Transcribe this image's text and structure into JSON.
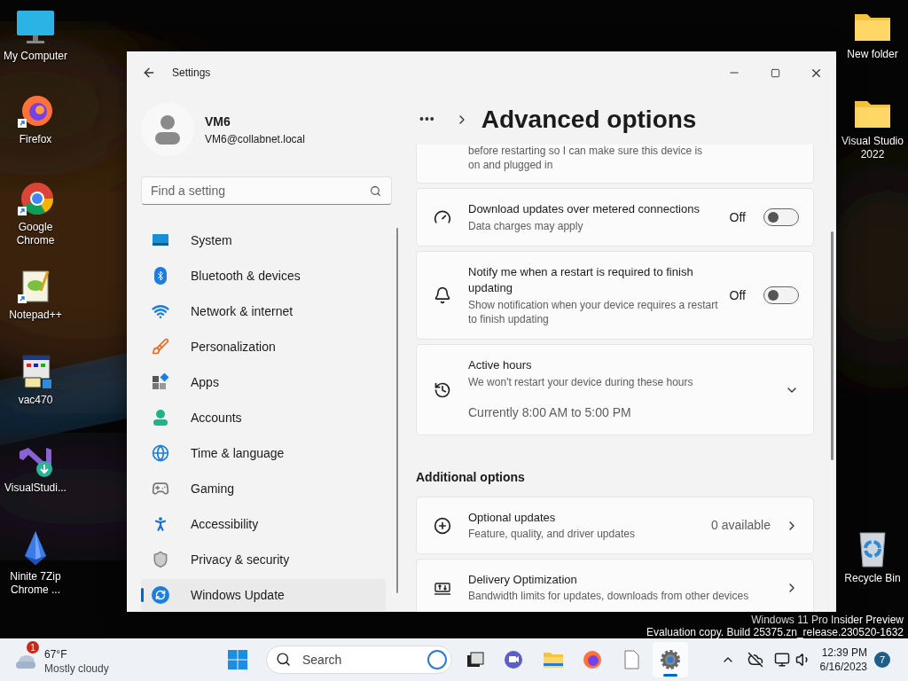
{
  "desktop": {
    "left_icons": [
      {
        "label": "My Computer"
      },
      {
        "label": "Firefox"
      },
      {
        "label": "Google Chrome"
      },
      {
        "label": "Notepad++"
      },
      {
        "label": "vac470"
      },
      {
        "label": "VisualStudi..."
      },
      {
        "label": "Ninite 7Zip Chrome ..."
      }
    ],
    "right_icons": [
      {
        "label": "New folder"
      },
      {
        "label": "Visual Studio 2022"
      },
      {
        "label": "Recycle Bin"
      }
    ],
    "watermark": [
      "Windows 11 Pro Insider Preview",
      "Evaluation copy. Build 25375.zn_release.230520-1632"
    ]
  },
  "window": {
    "title": "Settings",
    "user": {
      "name": "VM6",
      "email": "VM6@collabnet.local"
    },
    "search": {
      "placeholder": "Find a setting"
    },
    "nav": [
      {
        "label": "System",
        "selected": false
      },
      {
        "label": "Bluetooth & devices",
        "selected": false
      },
      {
        "label": "Network & internet",
        "selected": false
      },
      {
        "label": "Personalization",
        "selected": false
      },
      {
        "label": "Apps",
        "selected": false
      },
      {
        "label": "Accounts",
        "selected": false
      },
      {
        "label": "Time & language",
        "selected": false
      },
      {
        "label": "Gaming",
        "selected": false
      },
      {
        "label": "Accessibility",
        "selected": false
      },
      {
        "label": "Privacy & security",
        "selected": false
      },
      {
        "label": "Windows Update",
        "selected": true
      }
    ],
    "breadcrumb": "•••",
    "page_title": "Advanced options",
    "cards": [
      {
        "kind": "text",
        "description": "before restarting so I can make sure this device is on and plugged in"
      },
      {
        "kind": "toggle",
        "title": "Download updates over metered connections",
        "description": "Data charges may apply",
        "state_label": "Off",
        "on": false
      },
      {
        "kind": "toggle",
        "title": "Notify me when a restart is required to finish updating",
        "description": "Show notification when your device requires a restart to finish updating",
        "state_label": "Off",
        "on": false
      },
      {
        "kind": "expander",
        "title": "Active hours",
        "description": "We won't restart your device during these hours",
        "detail": "Currently 8:00 AM to 5:00 PM",
        "expanded": false
      }
    ],
    "additional": {
      "heading": "Additional options",
      "cards": [
        {
          "kind": "link",
          "title": "Optional updates",
          "description": "Feature, quality, and driver updates",
          "value": "0 available"
        },
        {
          "kind": "link",
          "title": "Delivery Optimization",
          "description": "Bandwidth limits for updates, downloads from other devices"
        }
      ]
    }
  },
  "taskbar": {
    "weather": {
      "badge": "1",
      "temperature": "67°F",
      "condition": "Mostly cloudy"
    },
    "search_placeholder": "Search",
    "apps": [
      {
        "selected": false
      },
      {
        "selected": false
      },
      {
        "selected": false
      },
      {
        "selected": false
      },
      {
        "selected": false
      },
      {
        "selected": true
      }
    ],
    "time": "12:39 PM",
    "date": "6/16/2023",
    "notifications": "7"
  }
}
